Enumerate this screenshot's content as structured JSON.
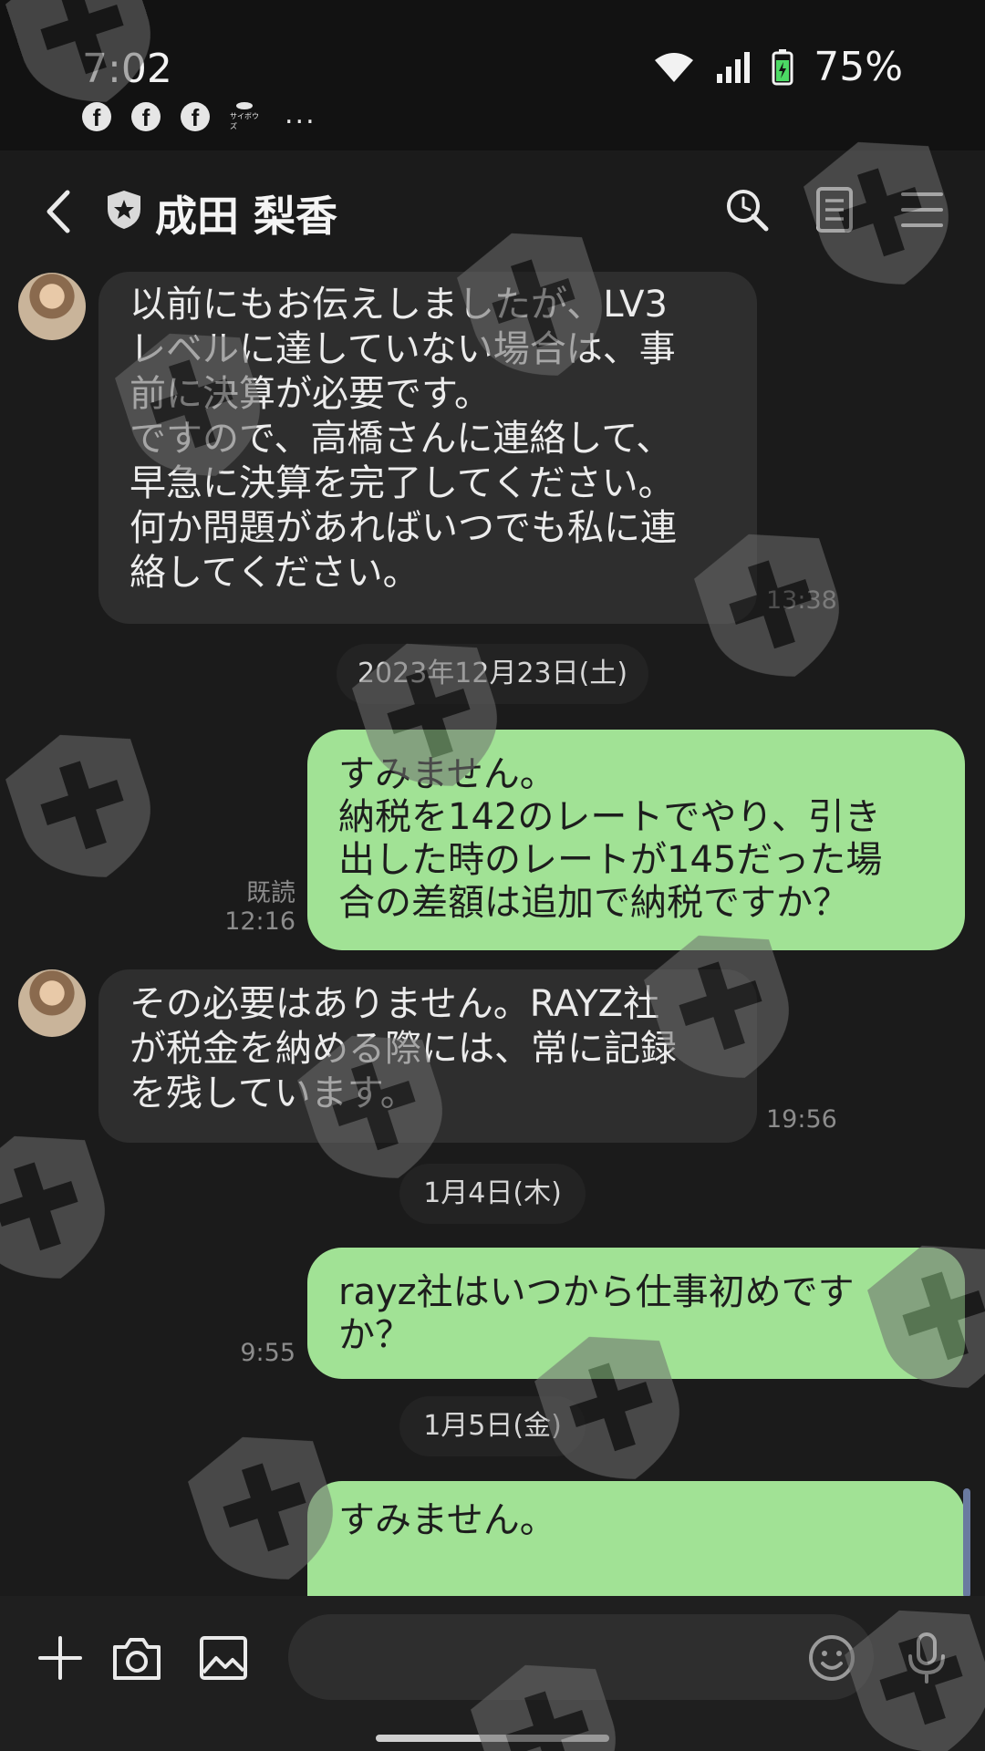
{
  "status_bar": {
    "time": "7:02",
    "battery_percent": "75%",
    "notification_icons": [
      "facebook-icon",
      "facebook-icon",
      "facebook-icon",
      "app-icon"
    ],
    "more_indicator": "...",
    "app_icon_caption": "サイボウズ"
  },
  "header": {
    "contact_name": "成田 梨香",
    "icons": [
      "back-icon",
      "shield-star-icon",
      "search-icon",
      "notes-icon",
      "menu-icon"
    ]
  },
  "messages": [
    {
      "direction": "incoming",
      "text": "以前にもお伝えしましたが、LV3\nレベルに達していない場合は、事\n前に決算が必要です。\nですので、高橋さんに連絡して、\n早急に決算を完了してください。\n何か問題があればいつでも私に連\n絡してください。",
      "time": "13:38"
    },
    {
      "type": "date",
      "label": "2023年12月23日(土)"
    },
    {
      "direction": "outgoing",
      "text": "すみません。\n納税を142のレートでやり、引き\n出した時のレートが145だった場\n合の差額は追加で納税ですか？",
      "read": "既読",
      "time": "12:16"
    },
    {
      "direction": "incoming",
      "text": "その必要はありません。RAYZ社\nが税金を納める際には、常に記録\nを残しています。",
      "time": "19:56"
    },
    {
      "type": "date",
      "label": "1月4日(木)"
    },
    {
      "direction": "outgoing",
      "text": "rayz社はいつから仕事初めです\nか？",
      "time": "9:55"
    },
    {
      "type": "date",
      "label": "1月5日(金)"
    },
    {
      "direction": "outgoing",
      "text": "すみません。"
    }
  ],
  "input_bar": {
    "placeholder": "",
    "icons": [
      "plus-icon",
      "camera-icon",
      "image-icon",
      "emoji-icon",
      "microphone-icon"
    ]
  },
  "colors": {
    "background": "#1b1b1b",
    "outgoing_bubble": "#a1e295",
    "incoming_bubble": "#2e2e2e",
    "watermark": "#5a5a5a"
  }
}
